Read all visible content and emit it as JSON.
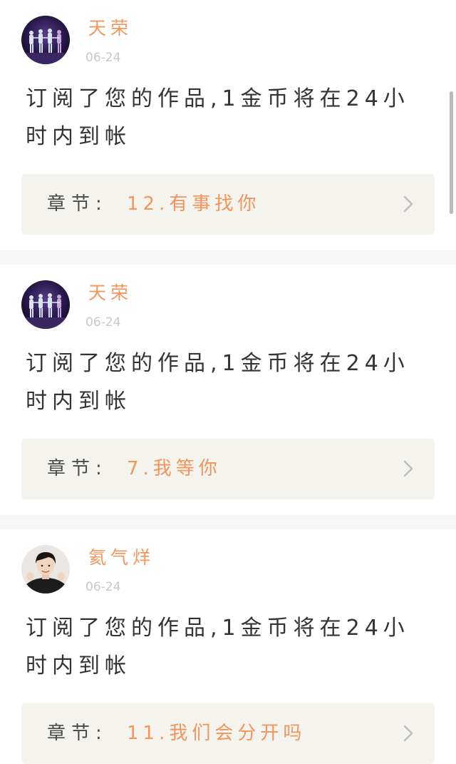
{
  "notifications": [
    {
      "user_name": "天荣",
      "date": "06-24",
      "message": "订阅了您的作品,1金币将在24小时内到帐",
      "chapter_label": "章节:",
      "chapter_title": "12.有事找你",
      "avatar": "concert-stage-avatar"
    },
    {
      "user_name": "天荣",
      "date": "06-24",
      "message": "订阅了您的作品,1金币将在24小时内到帐",
      "chapter_label": "章节:",
      "chapter_title": "7.我等你",
      "avatar": "concert-stage-avatar"
    },
    {
      "user_name": "氦气烊",
      "date": "06-24",
      "message": "订阅了您的作品,1金币将在24小时内到帐",
      "chapter_label": "章节:",
      "chapter_title": "11.我们会分开吗",
      "avatar": "person-portrait-avatar"
    }
  ],
  "colors": {
    "accent": "#f2955d",
    "date": "#c8c8c8",
    "text": "#333333",
    "chapter_bg": "#f4f3ed",
    "separator": "#f7f7f7"
  }
}
